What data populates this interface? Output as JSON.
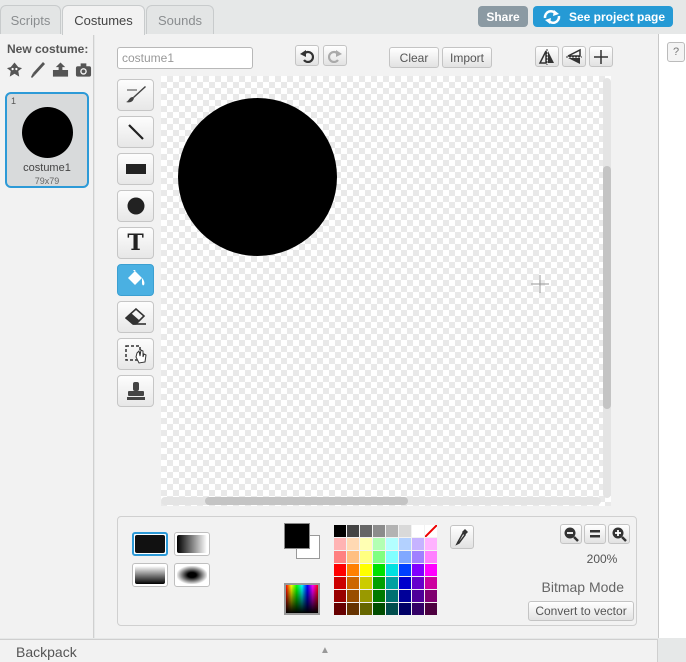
{
  "tabs": [
    {
      "label": "Scripts",
      "active": false
    },
    {
      "label": "Costumes",
      "active": true
    },
    {
      "label": "Sounds",
      "active": false
    }
  ],
  "header": {
    "share_label": "Share",
    "see_project_label": "See project page"
  },
  "sidebar": {
    "new_costume_label": "New costume:",
    "new_costume_icons": [
      "sprite-library-icon",
      "paint-brush-icon",
      "upload-icon",
      "camera-icon"
    ],
    "costumes": [
      {
        "number": "1",
        "name": "costume1",
        "size": "79x79"
      }
    ]
  },
  "editor": {
    "costume_name_placeholder": "costume1",
    "undo_icon": "undo-icon",
    "redo_icon": "redo-icon",
    "clear_label": "Clear",
    "import_label": "Import",
    "transform_icons": [
      "flip-horizontal-icon",
      "flip-vertical-icon",
      "set-center-icon"
    ],
    "tools": [
      {
        "name": "brush-tool",
        "icon": "brush-icon",
        "selected": false
      },
      {
        "name": "line-tool",
        "icon": "line-icon",
        "selected": false
      },
      {
        "name": "rectangle-tool",
        "icon": "rectangle-icon",
        "selected": false
      },
      {
        "name": "ellipse-tool",
        "icon": "ellipse-icon",
        "selected": false
      },
      {
        "name": "text-tool",
        "icon": "text-icon",
        "selected": false
      },
      {
        "name": "fill-tool",
        "icon": "paint-bucket-icon",
        "selected": true
      },
      {
        "name": "eraser-tool",
        "icon": "eraser-icon",
        "selected": false
      },
      {
        "name": "select-tool",
        "icon": "select-icon",
        "selected": false
      },
      {
        "name": "stamp-tool",
        "icon": "stamp-icon",
        "selected": false
      }
    ],
    "text_tool_glyph": "T"
  },
  "bottom": {
    "primary_color": "#000000",
    "secondary_color": "#ffffff",
    "zoom_label": "200%",
    "mode_label": "Bitmap Mode",
    "convert_label": "Convert to vector",
    "palette": [
      "#000000",
      "#444444",
      "#666666",
      "#8c8c8c",
      "#b3b3b3",
      "#d9d9d9",
      "#ffffff",
      "none",
      "#ffb3b3",
      "#ffd9b3",
      "#ffffb3",
      "#b3ffb3",
      "#b3ffff",
      "#b3d1ff",
      "#c6b3ff",
      "#ffb3ff",
      "#ff8080",
      "#ffbf80",
      "#ffff80",
      "#80ff80",
      "#80ffff",
      "#80a8ff",
      "#a080ff",
      "#ff80ff",
      "#ff0000",
      "#ff8000",
      "#ffff00",
      "#00e000",
      "#00e0e0",
      "#0040ff",
      "#8000ff",
      "#ff00ff",
      "#cc0000",
      "#cc6600",
      "#cccc00",
      "#00a000",
      "#00a0a0",
      "#0000cc",
      "#6600cc",
      "#cc00a0",
      "#990000",
      "#994d00",
      "#999900",
      "#007a00",
      "#007070",
      "#000099",
      "#4d0099",
      "#800070",
      "#660000",
      "#663300",
      "#666600",
      "#004d00",
      "#004d4d",
      "#000066",
      "#330066",
      "#4d0040"
    ]
  },
  "backpack": {
    "label": "Backpack"
  },
  "help": {
    "label": "?"
  }
}
